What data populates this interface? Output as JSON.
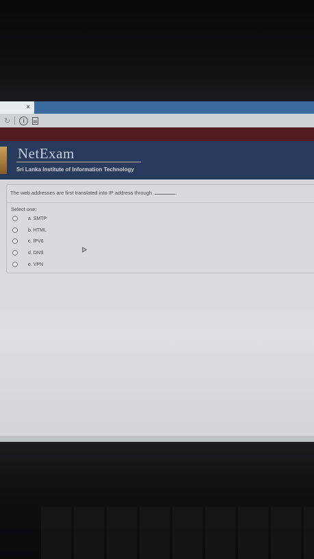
{
  "browser": {
    "tab_close_glyph": "×",
    "reload_glyph": "↻",
    "info_glyph": "i"
  },
  "site": {
    "logo": "NetExam",
    "institute": "Sri Lanka Institute of Information Technology"
  },
  "question": {
    "text": "The web addresses are first translated into IP address through",
    "blank_suffix": ".",
    "select_label": "Select one:",
    "options": [
      {
        "label": "a. SMTP",
        "selected": false
      },
      {
        "label": "b. HTML",
        "selected": false
      },
      {
        "label": "c. IPV6",
        "selected": false
      },
      {
        "label": "d. DNS",
        "selected": false
      },
      {
        "label": "e. VPN",
        "selected": false
      }
    ]
  },
  "colors": {
    "header": "#283b5c",
    "banner": "#531b22",
    "tab_strip": "#3a6a9e"
  }
}
